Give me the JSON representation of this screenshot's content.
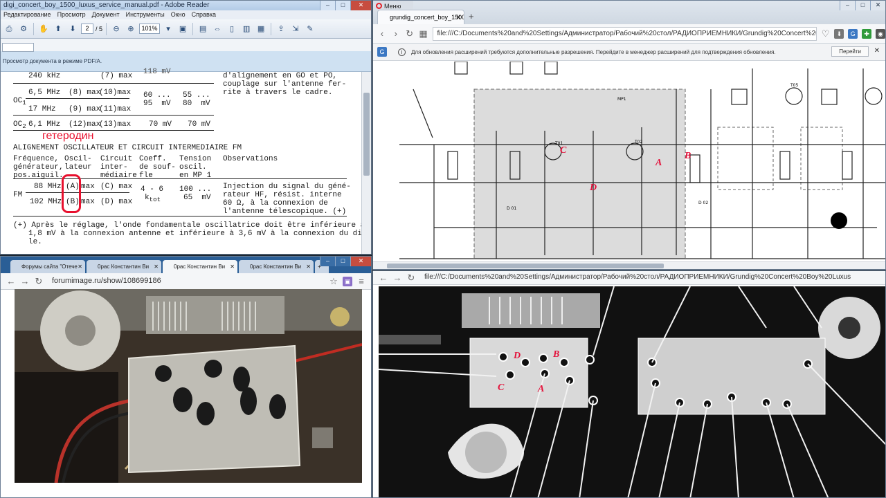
{
  "reader": {
    "title": "digi_concert_boy_1500_luxus_service_manual.pdf - Adobe Reader",
    "menu": [
      "Редактирование",
      "Просмотр",
      "Документ",
      "Инструменты",
      "Окно",
      "Справка"
    ],
    "page_current": "2",
    "page_total": "/ 5",
    "zoom": "101%",
    "info_text": "Просмотр документа в режиме PDF/A.",
    "doc": {
      "line_240": "240 kHz",
      "line_240_osc": "(7) max",
      "line_240_circ": "118 mV",
      "obs_1": "d'alignement en GO et PO,",
      "obs_2": "couplage sur l'antenne fer-",
      "obs_3": "rite à travers le cadre.",
      "oc1": "OC",
      "oc1_sub": "1",
      "r1_freq": "6,5 MHz",
      "r1_osc": "(8) max",
      "r1_circ": "(10)max",
      "r1_coef": "60 ...",
      "r1_tens": "55 ...",
      "r1b_coef": "95  mV",
      "r1b_tens": "80  mV",
      "r2_freq": "17 MHz",
      "r2_osc": "(9) max",
      "r2_circ": "(11)max",
      "oc2": "OC",
      "oc2_sub": "2",
      "r3_freq": "6,1 MHz",
      "r3_osc": "(12)max",
      "r3_circ": "(13)max",
      "r3_coef": "70 mV",
      "r3_tens": "70 mV",
      "handwritten": "гетеродин",
      "section_title": "ALIGNEMENT OSCILLATEUR ET CIRCUIT INTERMEDIAIRE FM",
      "h_freq": "Fréquence,\ngénérateur,\npos.aiguil.",
      "h_osc": "Oscil-\nlateur",
      "h_circ": "Circuit\ninter-\nmédiaire",
      "h_coef": "Coeff.\nde souf-\nfle",
      "h_tens": "Tension\noscil.\nen MP 1",
      "h_obs": "Observations",
      "fm": "FM",
      "f1": "88 MHz",
      "f1_osc": "(A)",
      "f1_max": "max",
      "f1_circ": "(C) max",
      "f1_coef": "4 - 6",
      "f1_tens": "100 ...",
      "f2": "102 MHz",
      "f2_osc": "(B)",
      "f2_max": "max",
      "f2_circ": "(D) max",
      "f2_coef": "k",
      "f2_coef_sub": "tot",
      "f2_tens": "65  mV",
      "fm_obs_1": "Injection du signal du géné-",
      "fm_obs_2": "rateur HF, résist. interne",
      "fm_obs_3": "60 Ω, à la connexion de",
      "fm_obs_4": "l'antenne télescopique. (+)",
      "note_1": "(+) Après le réglage, l'onde fondamentale oscillatrice doit être inférieure à",
      "note_2": "1,8 mV à la connexion antenne et inférieure à 3,6 mV à la connexion du dipô-",
      "note_3": "le."
    }
  },
  "opera": {
    "menu": "Меню",
    "tab": "grundig_concert_boy_1500_",
    "url": "file:///C:/Documents%20and%20Settings/Администратор/Рабочий%20стол/РАДИОПРИЕМНИКИ/Grundig%20Concert%20Boy%20Lux",
    "notice": "Для обновления расширений требуются дополнительные разрешения. Перейдите в менеджер расширений для подтверждения обновления.",
    "notice_button": "Перейти",
    "schematic_labels": {
      "A": "A",
      "B": "B",
      "C": "C",
      "D": "D",
      "t01": "T01",
      "t02": "T02",
      "t05": "T05",
      "mp1": "MP1",
      "d01": "D 01",
      "d02": "D 02"
    }
  },
  "chrome": {
    "tabs": [
      "Форумы сайта \"Отече",
      "0рас Константин Ви",
      "0рас Константин Ви",
      "0рас Константин Ви"
    ],
    "url": "forumimage.ru/show/108699186"
  },
  "scan": {
    "url": "file:///C:/Documents%20and%20Settings/Администратор/Рабочий%20стол/РАДИОПРИЕМНИКИ/Grundig%20Concert%20Boy%20Luxus",
    "labels": {
      "A": "A",
      "B": "B",
      "C": "C",
      "D": "D"
    }
  },
  "colors": {
    "annotation_red": "#e8102e",
    "reader_title": "#c9dcf1",
    "chrome_tabbar": "#2a5e96"
  }
}
